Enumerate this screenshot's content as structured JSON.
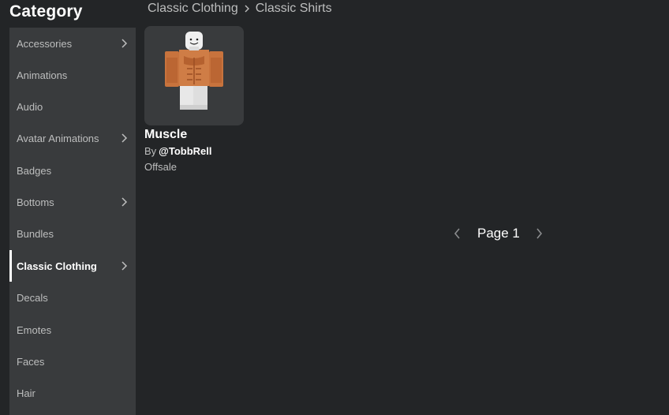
{
  "sidebar": {
    "title": "Category",
    "items": [
      {
        "label": "Accessories",
        "has_arrow": true,
        "active": false
      },
      {
        "label": "Animations",
        "has_arrow": false,
        "active": false
      },
      {
        "label": "Audio",
        "has_arrow": false,
        "active": false
      },
      {
        "label": "Avatar Animations",
        "has_arrow": true,
        "active": false
      },
      {
        "label": "Badges",
        "has_arrow": false,
        "active": false
      },
      {
        "label": "Bottoms",
        "has_arrow": true,
        "active": false
      },
      {
        "label": "Bundles",
        "has_arrow": false,
        "active": false
      },
      {
        "label": "Classic Clothing",
        "has_arrow": true,
        "active": true
      },
      {
        "label": "Decals",
        "has_arrow": false,
        "active": false
      },
      {
        "label": "Emotes",
        "has_arrow": false,
        "active": false
      },
      {
        "label": "Faces",
        "has_arrow": false,
        "active": false
      },
      {
        "label": "Hair",
        "has_arrow": false,
        "active": false
      }
    ]
  },
  "breadcrumb": {
    "items": [
      "Classic Clothing",
      "Classic Shirts"
    ]
  },
  "results": [
    {
      "name": "Muscle",
      "by_prefix": "By",
      "creator": "@TobbRell",
      "price": "Offsale",
      "thumbnail_icon": "avatar-shirt-thumbnail"
    }
  ],
  "pagination": {
    "label": "Page 1",
    "prev_icon": "chevron-left-icon",
    "next_icon": "chevron-right-icon"
  },
  "colors": {
    "background": "#232527",
    "sidebar": "#393b3d",
    "text_primary": "#ffffff",
    "text_secondary": "#bdbebe"
  }
}
